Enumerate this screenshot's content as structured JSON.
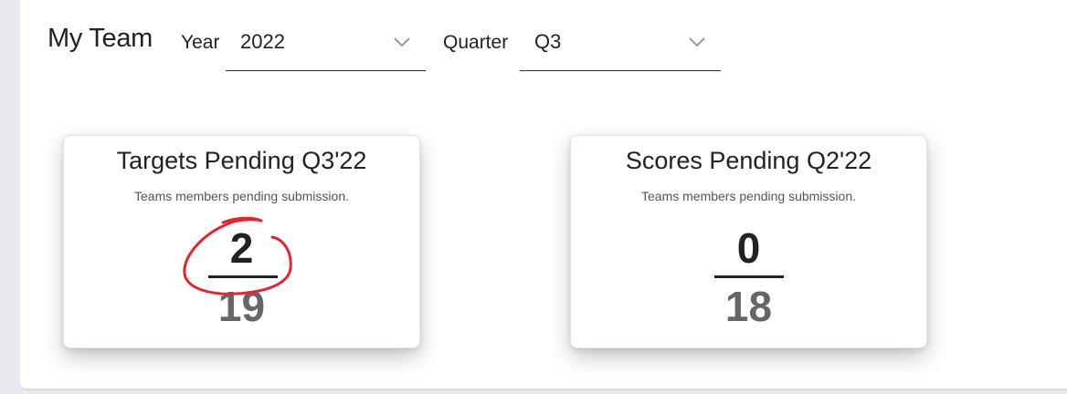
{
  "header": {
    "title": "My Team",
    "year_label": "Year",
    "year_value": "2022",
    "quarter_label": "Quarter",
    "quarter_value": "Q3"
  },
  "cards": [
    {
      "title": "Targets Pending Q3'22",
      "subtitle": "Teams members pending submission.",
      "numerator": "2",
      "denominator": "19"
    },
    {
      "title": "Scores Pending Q2'22",
      "subtitle": "Teams members pending submission.",
      "numerator": "0",
      "denominator": "18"
    }
  ],
  "icons": {
    "dropdown": "chevron-down-icon"
  },
  "colors": {
    "annotation": "#e0262e",
    "text": "#222222",
    "denominator": "#666666"
  }
}
